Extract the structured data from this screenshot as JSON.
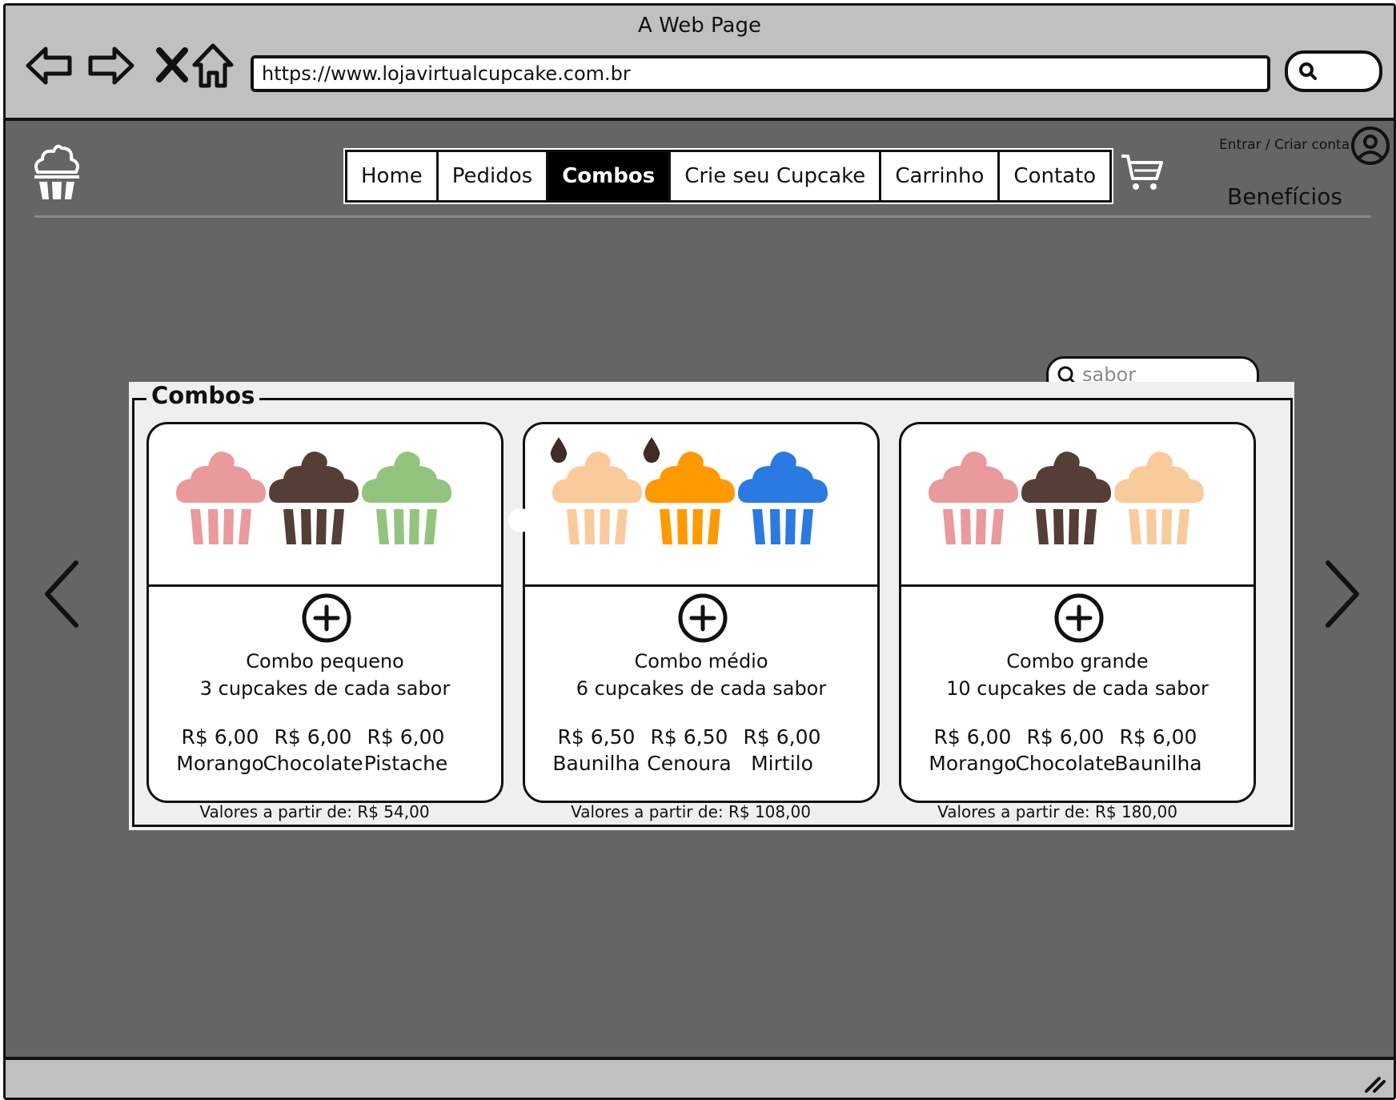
{
  "window": {
    "title": "A Web Page",
    "url": "https://www.lojavirtualcupcake.com.br"
  },
  "header": {
    "menu": [
      {
        "label": "Home",
        "active": false
      },
      {
        "label": "Pedidos",
        "active": false
      },
      {
        "label": "Combos",
        "active": true
      },
      {
        "label": "Crie seu Cupcake",
        "active": false
      },
      {
        "label": "Carrinho",
        "active": false
      },
      {
        "label": "Contato",
        "active": false
      }
    ],
    "login": "Entrar / Criar conta",
    "benefits": "Benefícios"
  },
  "search": {
    "placeholder": "sabor"
  },
  "combos": {
    "title": "Combos",
    "cards": [
      {
        "title": "Combo pequeno",
        "subtitle": "3 cupcakes de cada sabor",
        "footer": "Valores a partir de: R$ 54,00",
        "flavors": [
          {
            "price": "R$ 6,00",
            "name": "Morango",
            "color": "#e99a9a"
          },
          {
            "price": "R$ 6,00",
            "name": "Chocolate",
            "color": "#553e36"
          },
          {
            "price": "R$ 6,00",
            "name": "Pistache",
            "color": "#93c47d"
          }
        ]
      },
      {
        "title": "Combo médio",
        "subtitle": "6 cupcakes de cada sabor",
        "footer": "Valores a partir de: R$ 108,00",
        "flavors": [
          {
            "price": "R$ 6,50",
            "name": "Baunilha",
            "color": "#f9cb9c"
          },
          {
            "price": "R$ 6,50",
            "name": "Cenoura",
            "color": "#ff9900"
          },
          {
            "price": "R$ 6,00",
            "name": "Mirtilo",
            "color": "#2a7ae2"
          }
        ]
      },
      {
        "title": "Combo grande",
        "subtitle": "10 cupcakes de cada sabor",
        "footer": "Valores a partir de: R$ 180,00",
        "flavors": [
          {
            "price": "R$ 6,00",
            "name": "Morango",
            "color": "#e99a9a"
          },
          {
            "price": "R$ 6,00",
            "name": "Chocolate",
            "color": "#553e36"
          },
          {
            "price": "R$ 6,00",
            "name": "Baunilha",
            "color": "#f9cb9c"
          }
        ]
      }
    ]
  },
  "icons": {
    "back": "arrow-left-icon",
    "forward": "arrow-right-icon",
    "stop": "close-icon",
    "home": "home-icon",
    "logo": "cupcake-logo-icon",
    "cart": "cart-icon",
    "user": "user-circle-icon",
    "search": "search-icon",
    "add": "plus-circle-icon",
    "prev": "chevron-left-icon",
    "next": "chevron-right-icon",
    "drop": "drop-icon"
  }
}
